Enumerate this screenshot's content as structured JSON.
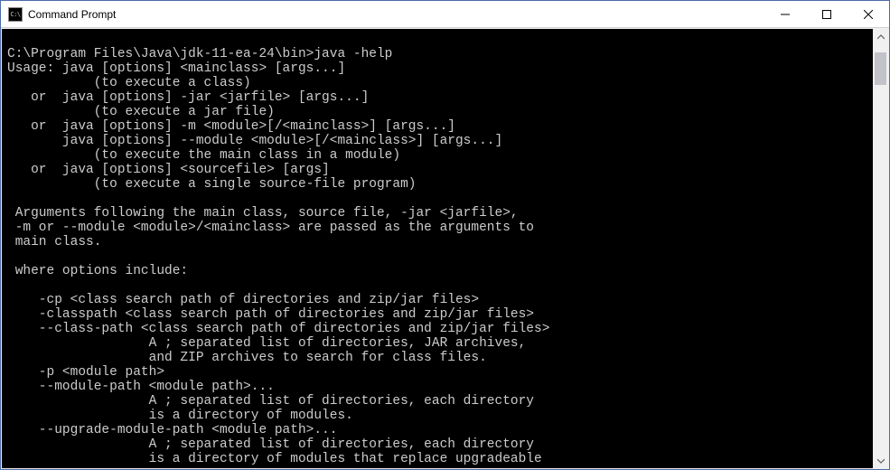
{
  "window": {
    "title": "Command Prompt",
    "icon_label": "C:\\"
  },
  "terminal": {
    "lines": [
      "",
      "C:\\Program Files\\Java\\jdk-11-ea-24\\bin>java -help",
      "Usage: java [options] <mainclass> [args...]",
      "           (to execute a class)",
      "   or  java [options] -jar <jarfile> [args...]",
      "           (to execute a jar file)",
      "   or  java [options] -m <module>[/<mainclass>] [args...]",
      "       java [options] --module <module>[/<mainclass>] [args...]",
      "           (to execute the main class in a module)",
      "   or  java [options] <sourcefile> [args]",
      "           (to execute a single source-file program)",
      "",
      " Arguments following the main class, source file, -jar <jarfile>,",
      " -m or --module <module>/<mainclass> are passed as the arguments to",
      " main class.",
      "",
      " where options include:",
      "",
      "    -cp <class search path of directories and zip/jar files>",
      "    -classpath <class search path of directories and zip/jar files>",
      "    --class-path <class search path of directories and zip/jar files>",
      "                  A ; separated list of directories, JAR archives,",
      "                  and ZIP archives to search for class files.",
      "    -p <module path>",
      "    --module-path <module path>...",
      "                  A ; separated list of directories, each directory",
      "                  is a directory of modules.",
      "    --upgrade-module-path <module path>...",
      "                  A ; separated list of directories, each directory",
      "                  is a directory of modules that replace upgradeable"
    ]
  }
}
